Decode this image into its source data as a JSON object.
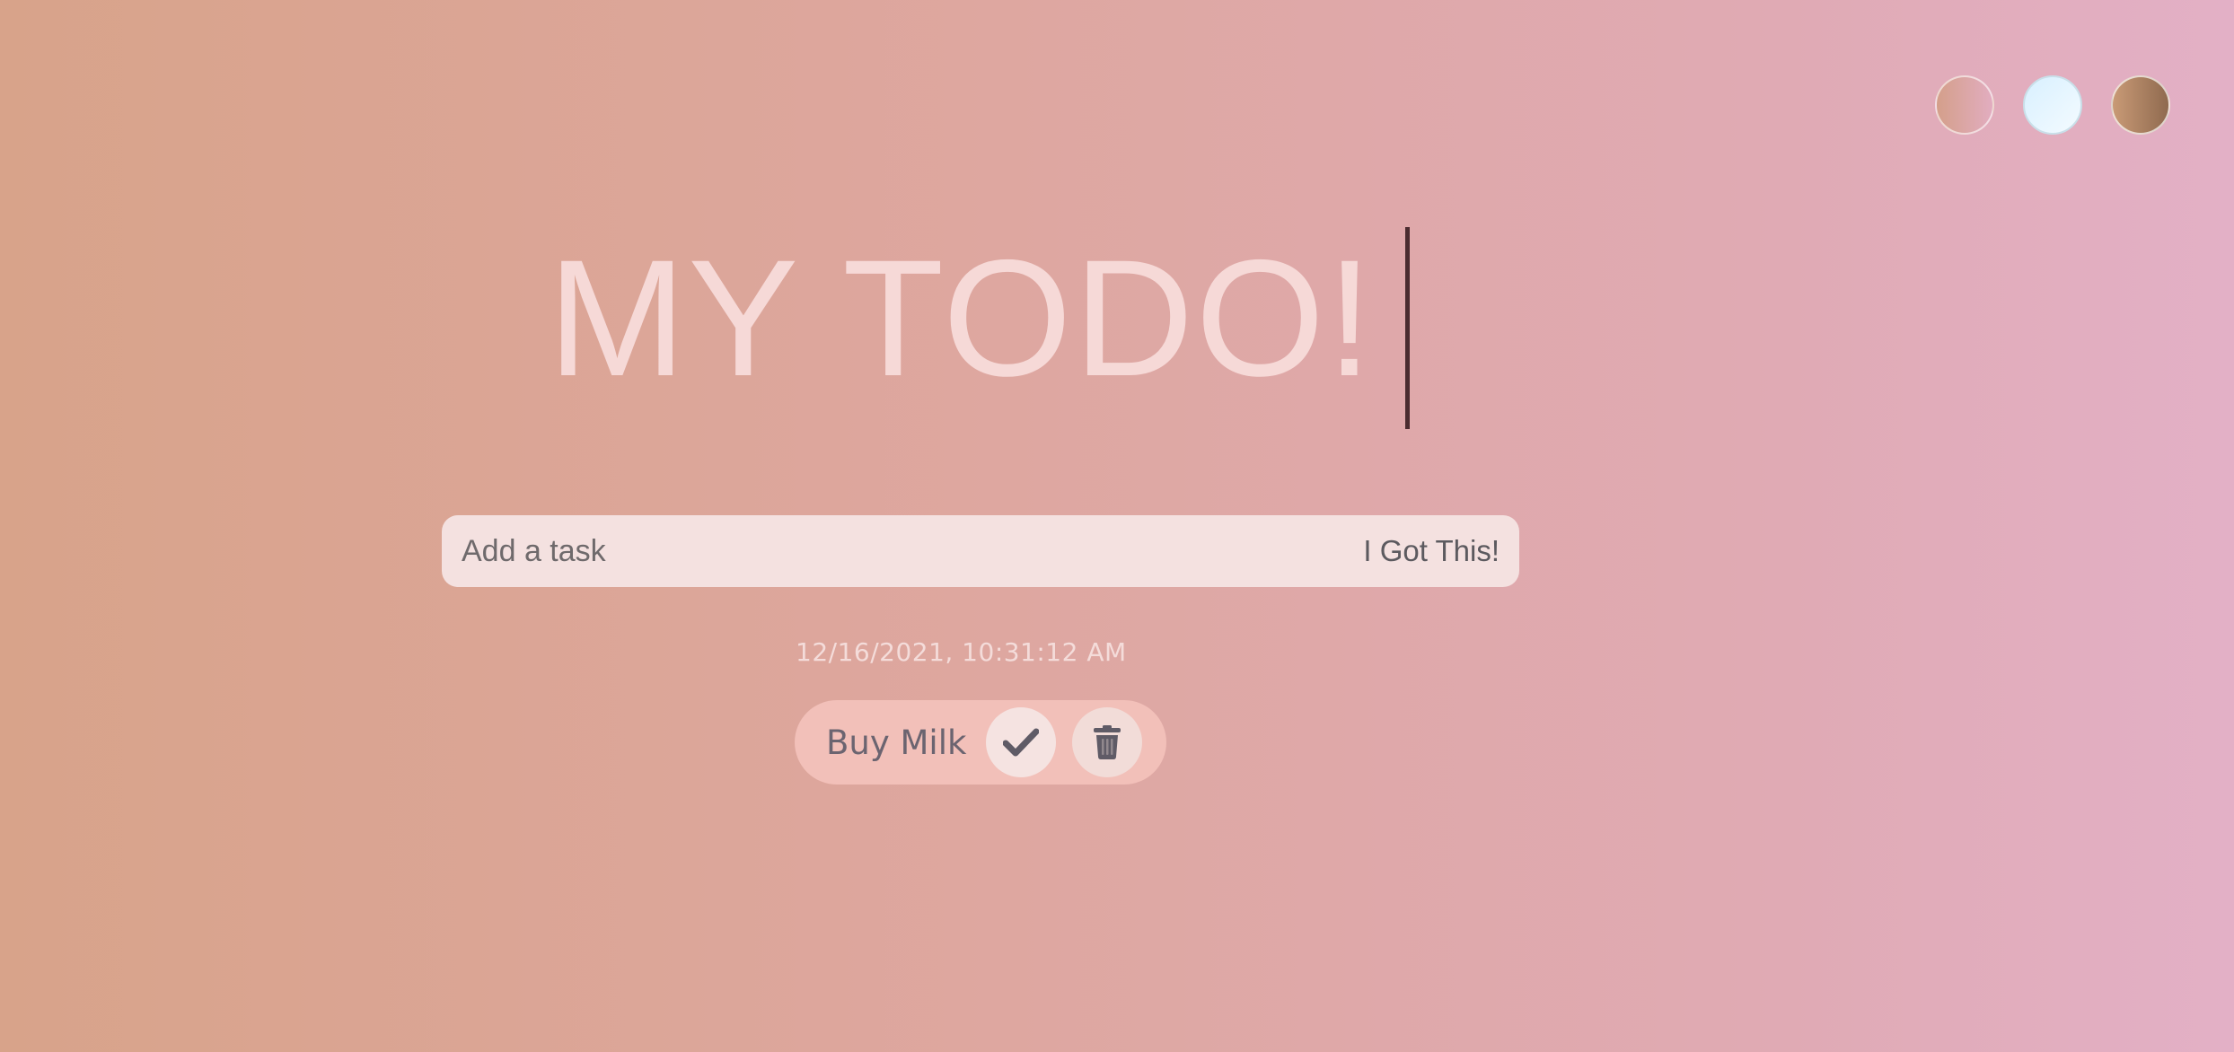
{
  "theme_picker": {
    "options": [
      {
        "name": "peach",
        "color": "#d8a38a"
      },
      {
        "name": "sky",
        "color": "#e6f6ff"
      },
      {
        "name": "mocha",
        "color": "#a97e5e"
      }
    ]
  },
  "header": {
    "title": "MY TODO!"
  },
  "form": {
    "placeholder": "Add a task",
    "submit_label": "I Got This!"
  },
  "datetime": "12/16/2021, 10:31:12 AM",
  "todos": [
    {
      "text": "Buy Milk",
      "complete_icon": "check-icon",
      "delete_icon": "trash-icon"
    }
  ],
  "colors": {
    "background_start": "#d8a38a",
    "background_end": "#e3b0c6",
    "title": "#f6d9d7",
    "input_bg": "#f4e1e0",
    "todo_bg": "#f2c0b9",
    "icon": "#5f5b66"
  }
}
